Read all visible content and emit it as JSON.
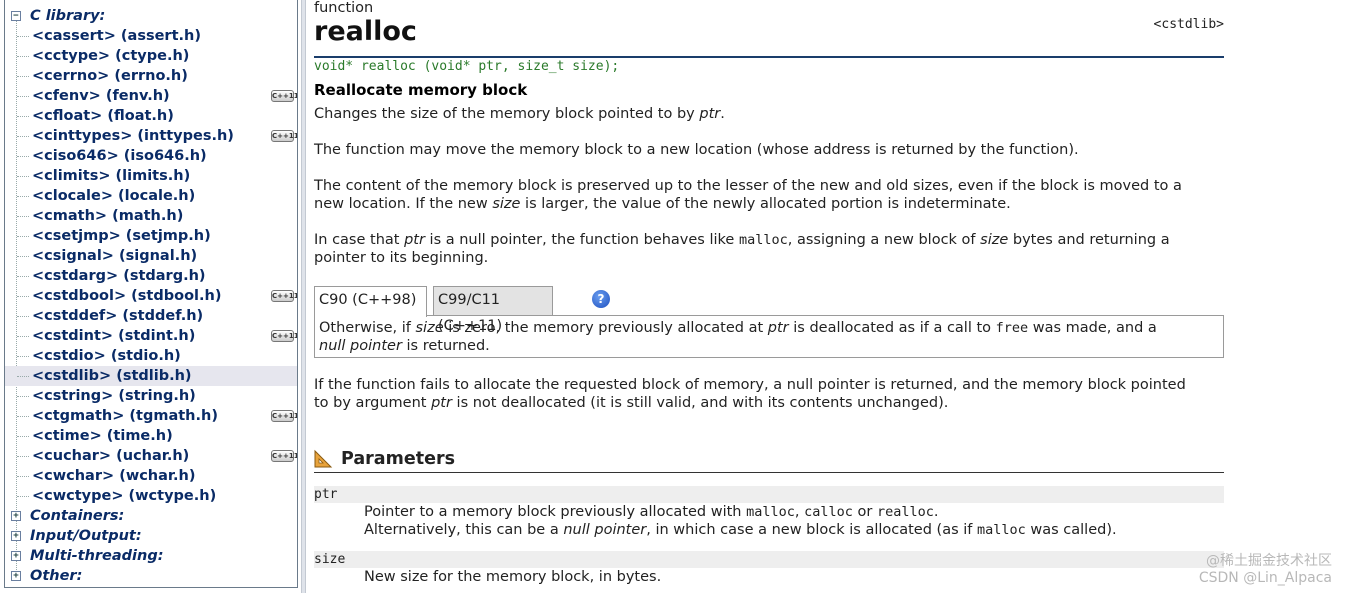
{
  "sidebar": {
    "root_label": "C library:",
    "items": [
      {
        "label": "<cassert> (assert.h)",
        "cxx": false
      },
      {
        "label": "<cctype> (ctype.h)",
        "cxx": false
      },
      {
        "label": "<cerrno> (errno.h)",
        "cxx": false
      },
      {
        "label": "<cfenv> (fenv.h)",
        "cxx": true
      },
      {
        "label": "<cfloat> (float.h)",
        "cxx": false
      },
      {
        "label": "<cinttypes> (inttypes.h)",
        "cxx": true
      },
      {
        "label": "<ciso646> (iso646.h)",
        "cxx": false
      },
      {
        "label": "<climits> (limits.h)",
        "cxx": false
      },
      {
        "label": "<clocale> (locale.h)",
        "cxx": false
      },
      {
        "label": "<cmath> (math.h)",
        "cxx": false
      },
      {
        "label": "<csetjmp> (setjmp.h)",
        "cxx": false
      },
      {
        "label": "<csignal> (signal.h)",
        "cxx": false
      },
      {
        "label": "<cstdarg> (stdarg.h)",
        "cxx": false
      },
      {
        "label": "<cstdbool> (stdbool.h)",
        "cxx": true
      },
      {
        "label": "<cstddef> (stddef.h)",
        "cxx": false
      },
      {
        "label": "<cstdint> (stdint.h)",
        "cxx": true
      },
      {
        "label": "<cstdio> (stdio.h)",
        "cxx": false
      },
      {
        "label": "<cstdlib> (stdlib.h)",
        "cxx": false,
        "selected": true
      },
      {
        "label": "<cstring> (string.h)",
        "cxx": false
      },
      {
        "label": "<ctgmath> (tgmath.h)",
        "cxx": true
      },
      {
        "label": "<ctime> (time.h)",
        "cxx": false
      },
      {
        "label": "<cuchar> (uchar.h)",
        "cxx": true
      },
      {
        "label": "<cwchar> (wchar.h)",
        "cxx": false
      },
      {
        "label": "<cwctype> (wctype.h)",
        "cxx": false
      }
    ],
    "categories": [
      "Containers:",
      "Input/Output:",
      "Multi-threading:",
      "Other:"
    ],
    "cxx_badge": "C++11",
    "expand_symbol": "+",
    "collapse_symbol": "−"
  },
  "main": {
    "kind": "function",
    "name": "realloc",
    "header": "<cstdlib>",
    "prototype": "void* realloc (void* ptr, size_t size);",
    "subtitle": "Reallocate memory block",
    "p1": {
      "a": "Changes the size of the memory block pointed to by ",
      "b": "ptr",
      "c": "."
    },
    "p2": "The function may move the memory block to a new location (whose address is returned by the function).",
    "p3": {
      "a": "The content of the memory block is preserved up to the lesser of the new and old sizes, even if the block is moved to a",
      "b": "new location. If the new ",
      "c": "size",
      "d": " is larger, the value of the newly allocated portion is indeterminate."
    },
    "p4": {
      "a": "In case that ",
      "b": "ptr",
      "c": " is a null pointer, the function behaves like ",
      "d": "malloc",
      "e": ", assigning a new block of ",
      "f": "size",
      "g": " bytes and returning a",
      "h": "pointer to its beginning."
    },
    "tabs": [
      "C90 (C++98)",
      "C99/C11 (C++11)"
    ],
    "help_icon_label": "?",
    "tab_text": {
      "a": "Otherwise, if ",
      "b": "size",
      "c": " is zero, the memory previously allocated at ",
      "d": "ptr",
      "e": " is deallocated as if a call to ",
      "f": "free",
      "g": " was made, and a",
      "h": "null pointer",
      "i": " is returned."
    },
    "p5": {
      "a": "If the function fails to allocate the requested block of memory, a null pointer is returned, and the memory block pointed",
      "b": "to by argument ",
      "c": "ptr",
      "d": " is not deallocated (it is still valid, and with its contents unchanged)."
    },
    "params_title": "Parameters",
    "params": [
      {
        "name": "ptr",
        "l1": {
          "a": "Pointer to a memory block previously allocated with ",
          "b": "malloc",
          "c": ", ",
          "d": "calloc",
          "e": " or ",
          "f": "realloc",
          "g": "."
        },
        "l2": {
          "a": "Alternatively, this can be a ",
          "b": "null pointer",
          "c": ", in which case a new block is allocated (as if ",
          "d": "malloc",
          "e": " was called)."
        }
      },
      {
        "name": "size",
        "l1": "New size for the memory block, in bytes."
      }
    ]
  },
  "watermark": {
    "line1": "@稀土掘金技术社区",
    "line2": "CSDN @Lin_Alpaca"
  },
  "colors": {
    "link": "#0a2b66",
    "prototype": "#2a7a2a",
    "rule": "#1a3d6b"
  }
}
